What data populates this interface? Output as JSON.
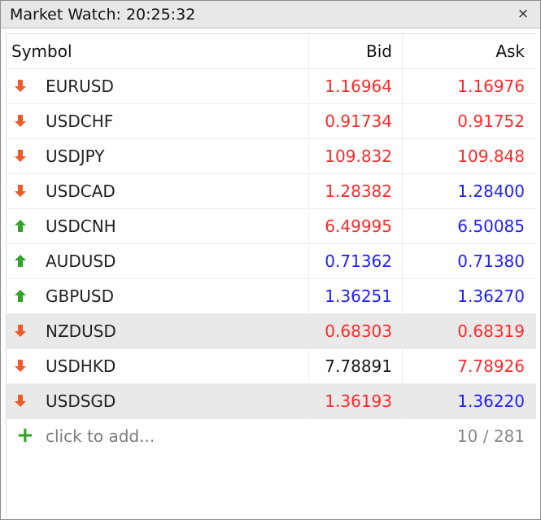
{
  "window": {
    "title": "Market Watch: 20:25:32",
    "close_label": "×"
  },
  "columns": {
    "symbol": "Symbol",
    "bid": "Bid",
    "ask": "Ask"
  },
  "colors": {
    "down": "#ff2a2a",
    "up": "#2020ff",
    "neutral": "#1a1a1a",
    "arrow_down": "#f05a28",
    "arrow_up": "#2fa32a"
  },
  "rows": [
    {
      "symbol": "EURUSD",
      "bid": "1.16964",
      "ask": "1.16976",
      "direction": "down",
      "bid_color": "down",
      "ask_color": "down",
      "selected": false
    },
    {
      "symbol": "USDCHF",
      "bid": "0.91734",
      "ask": "0.91752",
      "direction": "down",
      "bid_color": "down",
      "ask_color": "down",
      "selected": false
    },
    {
      "symbol": "USDJPY",
      "bid": "109.832",
      "ask": "109.848",
      "direction": "down",
      "bid_color": "down",
      "ask_color": "down",
      "selected": false
    },
    {
      "symbol": "USDCAD",
      "bid": "1.28382",
      "ask": "1.28400",
      "direction": "down",
      "bid_color": "down",
      "ask_color": "up",
      "selected": false
    },
    {
      "symbol": "USDCNH",
      "bid": "6.49995",
      "ask": "6.50085",
      "direction": "up",
      "bid_color": "down",
      "ask_color": "up",
      "selected": false
    },
    {
      "symbol": "AUDUSD",
      "bid": "0.71362",
      "ask": "0.71380",
      "direction": "up",
      "bid_color": "up",
      "ask_color": "up",
      "selected": false
    },
    {
      "symbol": "GBPUSD",
      "bid": "1.36251",
      "ask": "1.36270",
      "direction": "up",
      "bid_color": "up",
      "ask_color": "up",
      "selected": false
    },
    {
      "symbol": "NZDUSD",
      "bid": "0.68303",
      "ask": "0.68319",
      "direction": "down",
      "bid_color": "down",
      "ask_color": "down",
      "selected": true
    },
    {
      "symbol": "USDHKD",
      "bid": "7.78891",
      "ask": "7.78926",
      "direction": "down",
      "bid_color": "neutral",
      "ask_color": "down",
      "selected": false
    },
    {
      "symbol": "USDSGD",
      "bid": "1.36193",
      "ask": "1.36220",
      "direction": "down",
      "bid_color": "down",
      "ask_color": "up",
      "selected": true
    }
  ],
  "footer": {
    "add_label": "click to add...",
    "count": "10 / 281"
  }
}
